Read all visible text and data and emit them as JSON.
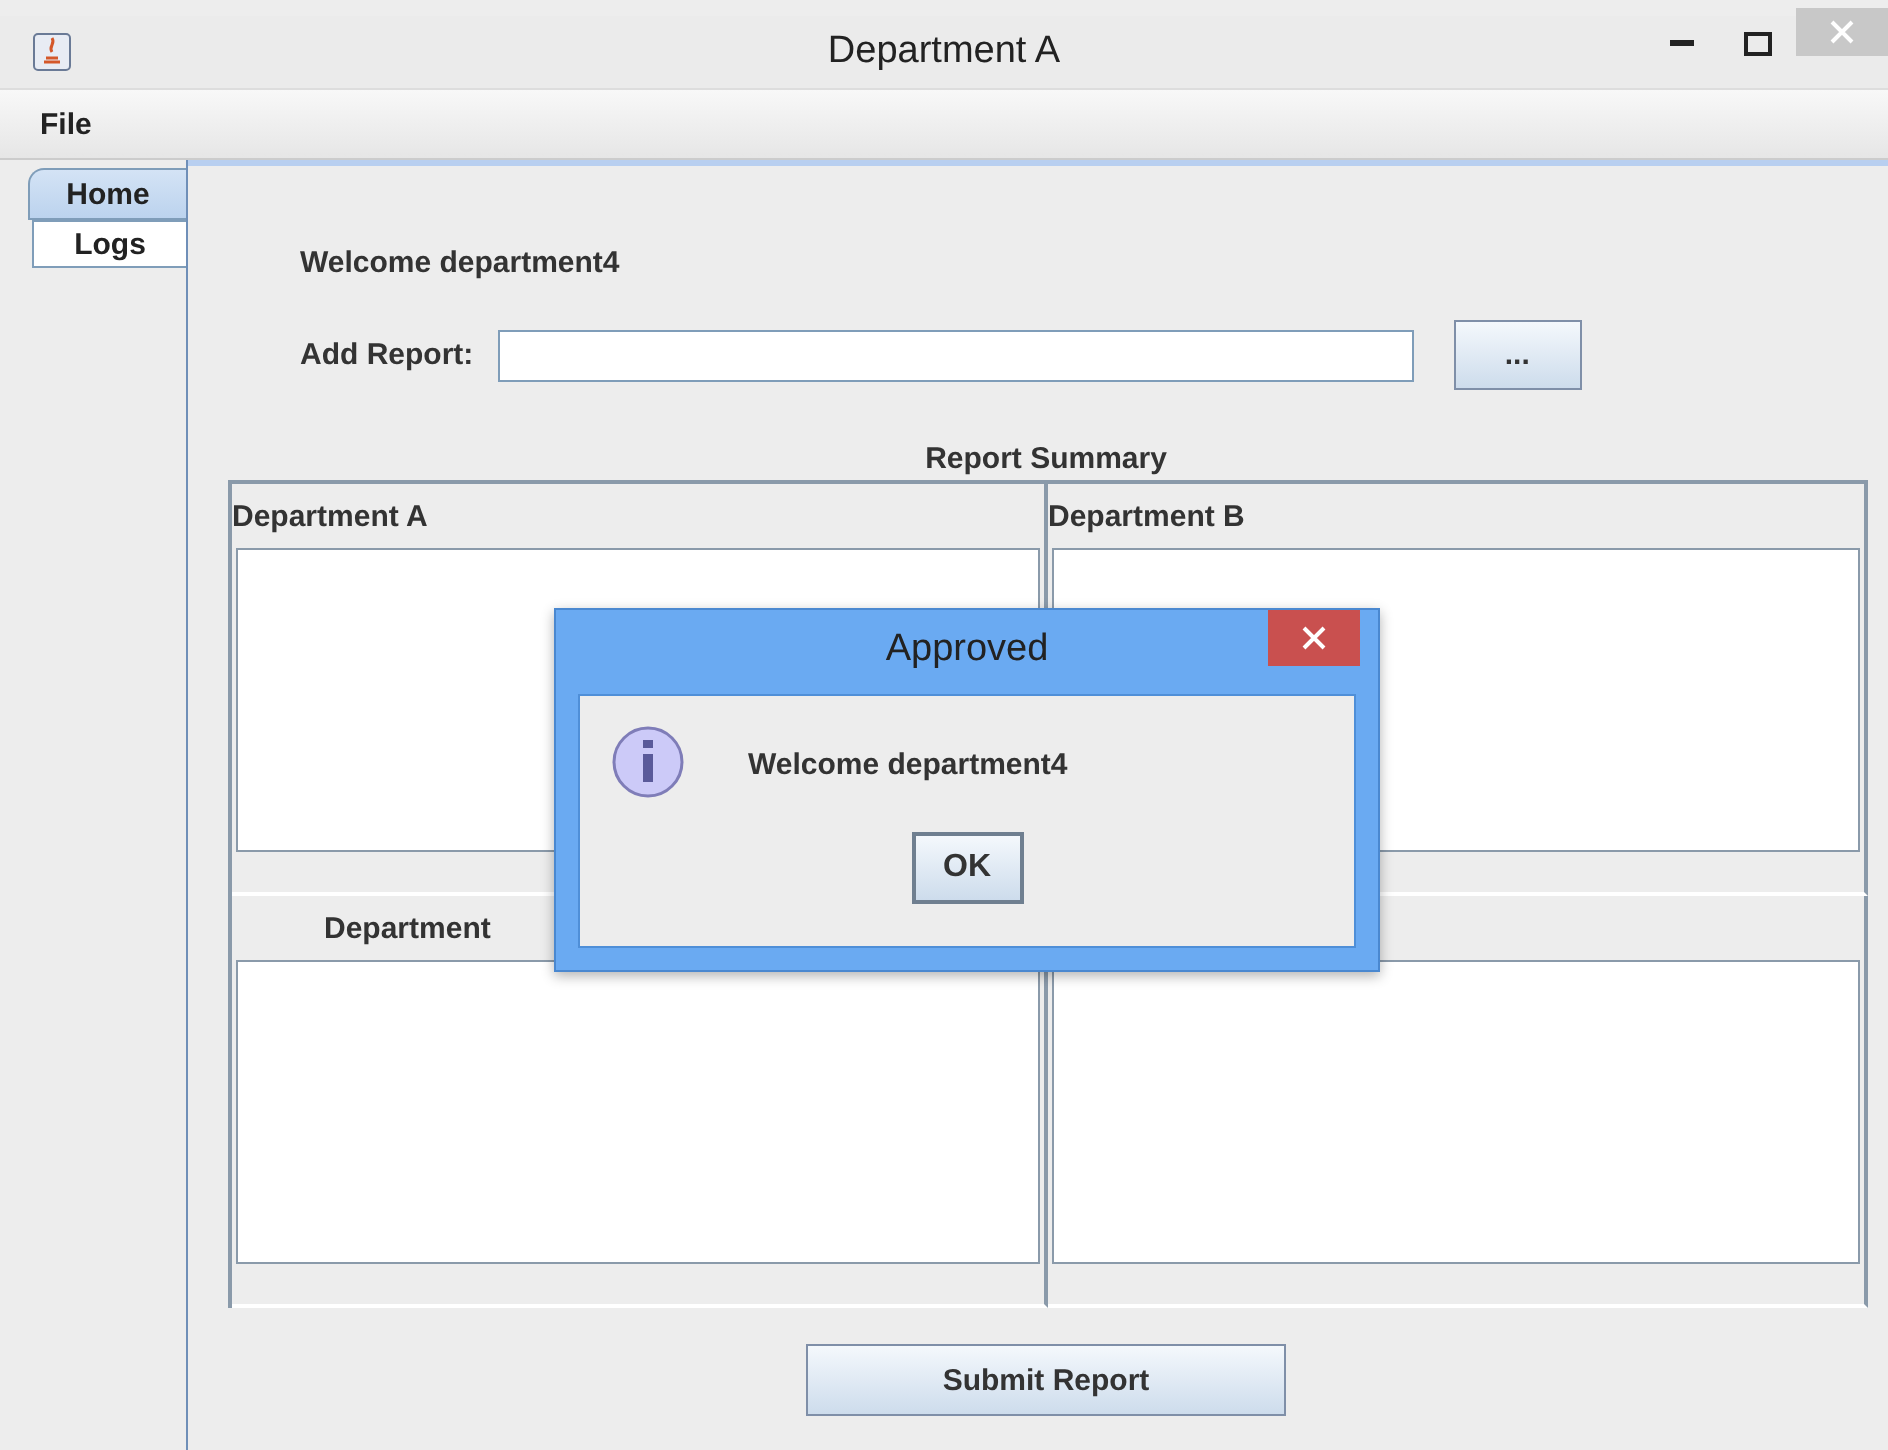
{
  "window": {
    "title": "Department A"
  },
  "menu": [
    "File"
  ],
  "tabs": [
    {
      "label": "Home",
      "selected": true
    },
    {
      "label": "Logs",
      "selected": false
    }
  ],
  "welcome": "Welcome department4",
  "add_report": {
    "label": "Add Report:",
    "browse_button": "..."
  },
  "summary": {
    "title": "Report Summary",
    "panels": [
      {
        "title": "Department A"
      },
      {
        "title": "Department B"
      },
      {
        "title": "Department"
      }
    ]
  },
  "submit_button": "Submit Report",
  "dialog": {
    "title": "Approved",
    "message": "Welcome department4",
    "ok_button": "OK"
  }
}
